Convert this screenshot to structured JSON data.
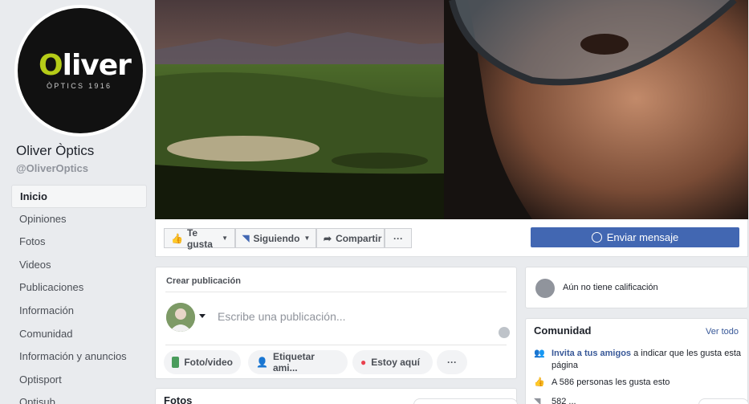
{
  "page": {
    "logo_o": "O",
    "logo_rest": "liver",
    "logo_sub": "ÒPTICS 1916",
    "name": "Oliver Òptics",
    "handle": "@OliverOptics"
  },
  "nav": [
    {
      "label": "Inicio",
      "active": true
    },
    {
      "label": "Opiniones"
    },
    {
      "label": "Fotos"
    },
    {
      "label": "Videos"
    },
    {
      "label": "Publicaciones"
    },
    {
      "label": "Información"
    },
    {
      "label": "Comunidad"
    },
    {
      "label": "Información y anuncios"
    },
    {
      "label": "Optisport"
    },
    {
      "label": "Optisub"
    }
  ],
  "actions": {
    "like": "Te gusta",
    "follow": "Siguiendo",
    "share": "Compartir",
    "more": "···",
    "message": "Enviar mensaje"
  },
  "create_post": {
    "title": "Crear publicación",
    "placeholder": "Escribe una publicación...",
    "photo_video": "Foto/video",
    "tag": "Etiquetar ami...",
    "checkin": "Estoy aquí",
    "more": "···"
  },
  "photos": {
    "title": "Fotos"
  },
  "rating": {
    "text": "Aún no tiene calificación"
  },
  "community": {
    "title": "Comunidad",
    "see_all": "Ver todo",
    "invite_link": "Invita a tus amigos",
    "invite_rest": "a indicar que les gusta esta página",
    "likes": "A 586 personas les gusta esto",
    "follows": "582 ..."
  },
  "colors": {
    "brand_blue": "#4267b2",
    "logo_green": "#b5cc18",
    "link": "#385898"
  }
}
